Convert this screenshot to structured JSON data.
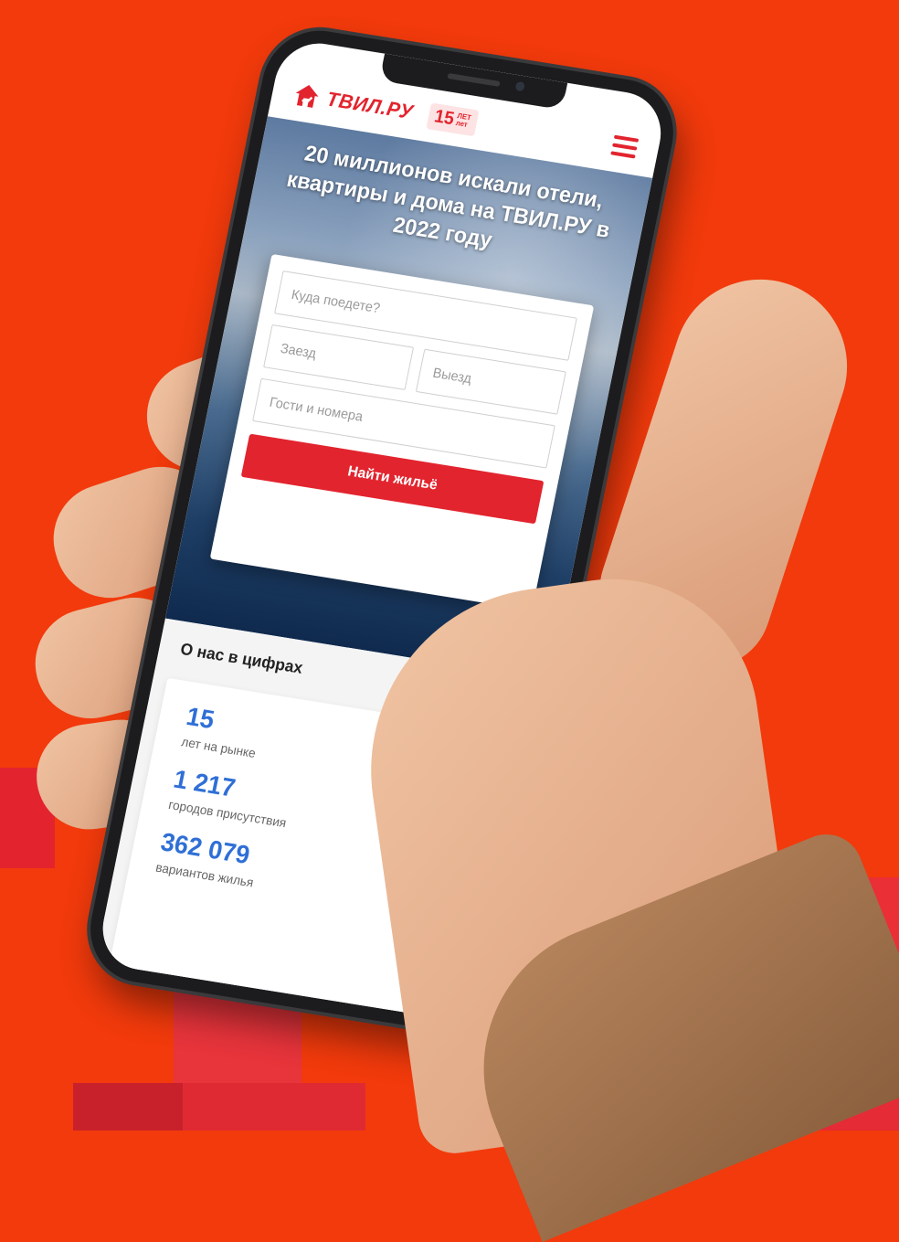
{
  "brand": {
    "name": "ТВИЛ.РУ",
    "anniversary_number": "15",
    "anniversary_small_top": "ЛЕТ",
    "anniversary_small_bottom": "лет"
  },
  "hero": {
    "title": "20 миллионов искали отели, квартиры и дома на ТВИЛ.РУ в 2022 году"
  },
  "search": {
    "destination_placeholder": "Куда поедете?",
    "checkin_placeholder": "Заезд",
    "checkout_placeholder": "Выезд",
    "guests_placeholder": "Гости и номера",
    "button_label": "Найти жильё"
  },
  "stats": {
    "title": "О нас в цифрах",
    "items": [
      {
        "value": "15",
        "label": "лет на рынке"
      },
      {
        "value": "1 217",
        "label": "городов присутствия"
      },
      {
        "value": "362 079",
        "label": "вариантов жилья"
      }
    ]
  },
  "colors": {
    "background": "#f23a0c",
    "brand_red": "#e2242e",
    "stat_blue": "#2f6fd6"
  },
  "icons": {
    "logo": "house-logo-icon",
    "menu": "hamburger-menu-icon"
  }
}
